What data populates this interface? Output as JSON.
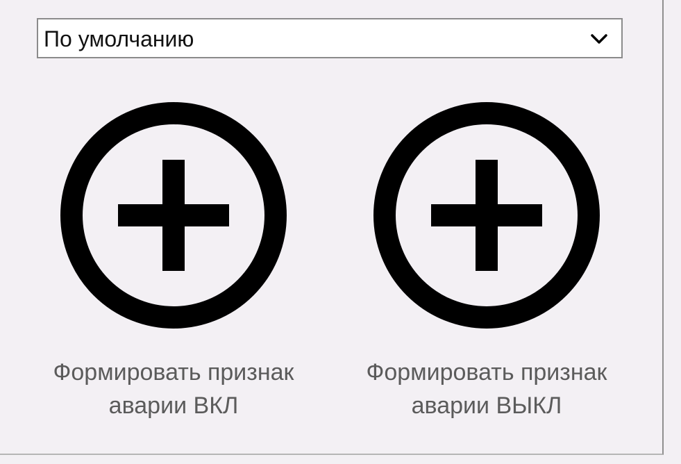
{
  "dropdown": {
    "selected": "По умолчанию",
    "icon": "chevron-down-icon"
  },
  "actions": [
    {
      "id": "alarm-on",
      "icon": "plus-circle-icon",
      "label_line1": "Формировать признак",
      "label_line2": "аварии ВКЛ"
    },
    {
      "id": "alarm-off",
      "icon": "plus-circle-icon",
      "label_line1": "Формировать признак",
      "label_line2": "аварии ВЫКЛ"
    }
  ],
  "colors": {
    "background": "#f3f0f4",
    "input_border": "#8b8b8b",
    "icon": "#000000",
    "label_text": "#5b5b5b"
  }
}
